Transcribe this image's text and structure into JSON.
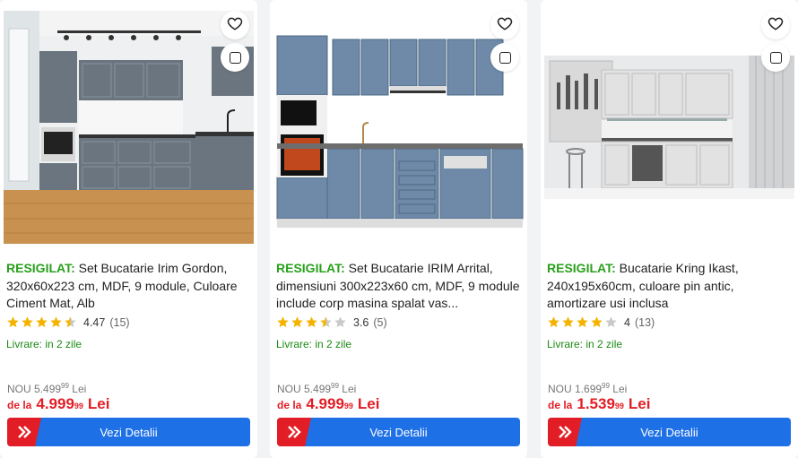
{
  "products": [
    {
      "tag": "RESIGILAT:",
      "title": "Set Bucatarie Irim Gordon, 320x60x223 cm, MDF, 9 module, Culoare Ciment Mat, Alb",
      "rating_value": "4.47",
      "rating_count": "(15)",
      "stars": 4.5,
      "delivery": "Livrare: in 2 zile",
      "old_prefix": "NOU",
      "old_int": "5.499",
      "old_dec": "99",
      "old_cur": "Lei",
      "price_prefix": "de la",
      "price_int": "4.999",
      "price_dec": "99",
      "price_cur": "Lei",
      "button_label": "Vezi Detalii"
    },
    {
      "tag": "RESIGILAT:",
      "title": "Set Bucatarie IRIM Arrital, dimensiuni 300x223x60 cm, MDF, 9 module include corp masina spalat vas...",
      "rating_value": "3.6",
      "rating_count": "(5)",
      "stars": 3.5,
      "delivery": "Livrare: in 2 zile",
      "old_prefix": "NOU",
      "old_int": "5.499",
      "old_dec": "99",
      "old_cur": "Lei",
      "price_prefix": "de la",
      "price_int": "4.999",
      "price_dec": "99",
      "price_cur": "Lei",
      "button_label": "Vezi Detalii"
    },
    {
      "tag": "RESIGILAT:",
      "title": "Bucatarie Kring Ikast, 240x195x60cm, culoare pin antic, amortizare usi inclusa",
      "rating_value": "4",
      "rating_count": "(13)",
      "stars": 4,
      "delivery": "Livrare: in 2 zile",
      "old_prefix": "NOU",
      "old_int": "1.699",
      "old_dec": "99",
      "old_cur": "Lei",
      "price_prefix": "de la",
      "price_int": "1.539",
      "price_dec": "99",
      "price_cur": "Lei",
      "button_label": "Vezi Detalii"
    }
  ],
  "colors": {
    "tag_green": "#29a01c",
    "delivery_green": "#1b8a14",
    "price_red": "#e21d25",
    "button_blue": "#1e70e6",
    "star_gold": "#f5b301",
    "star_empty": "#c9c9c9"
  },
  "icons": {
    "favorite": "heart-icon",
    "compare": "checkbox-icon",
    "button_arrow": "double-chevron-right-icon",
    "rating": "star-icon"
  }
}
